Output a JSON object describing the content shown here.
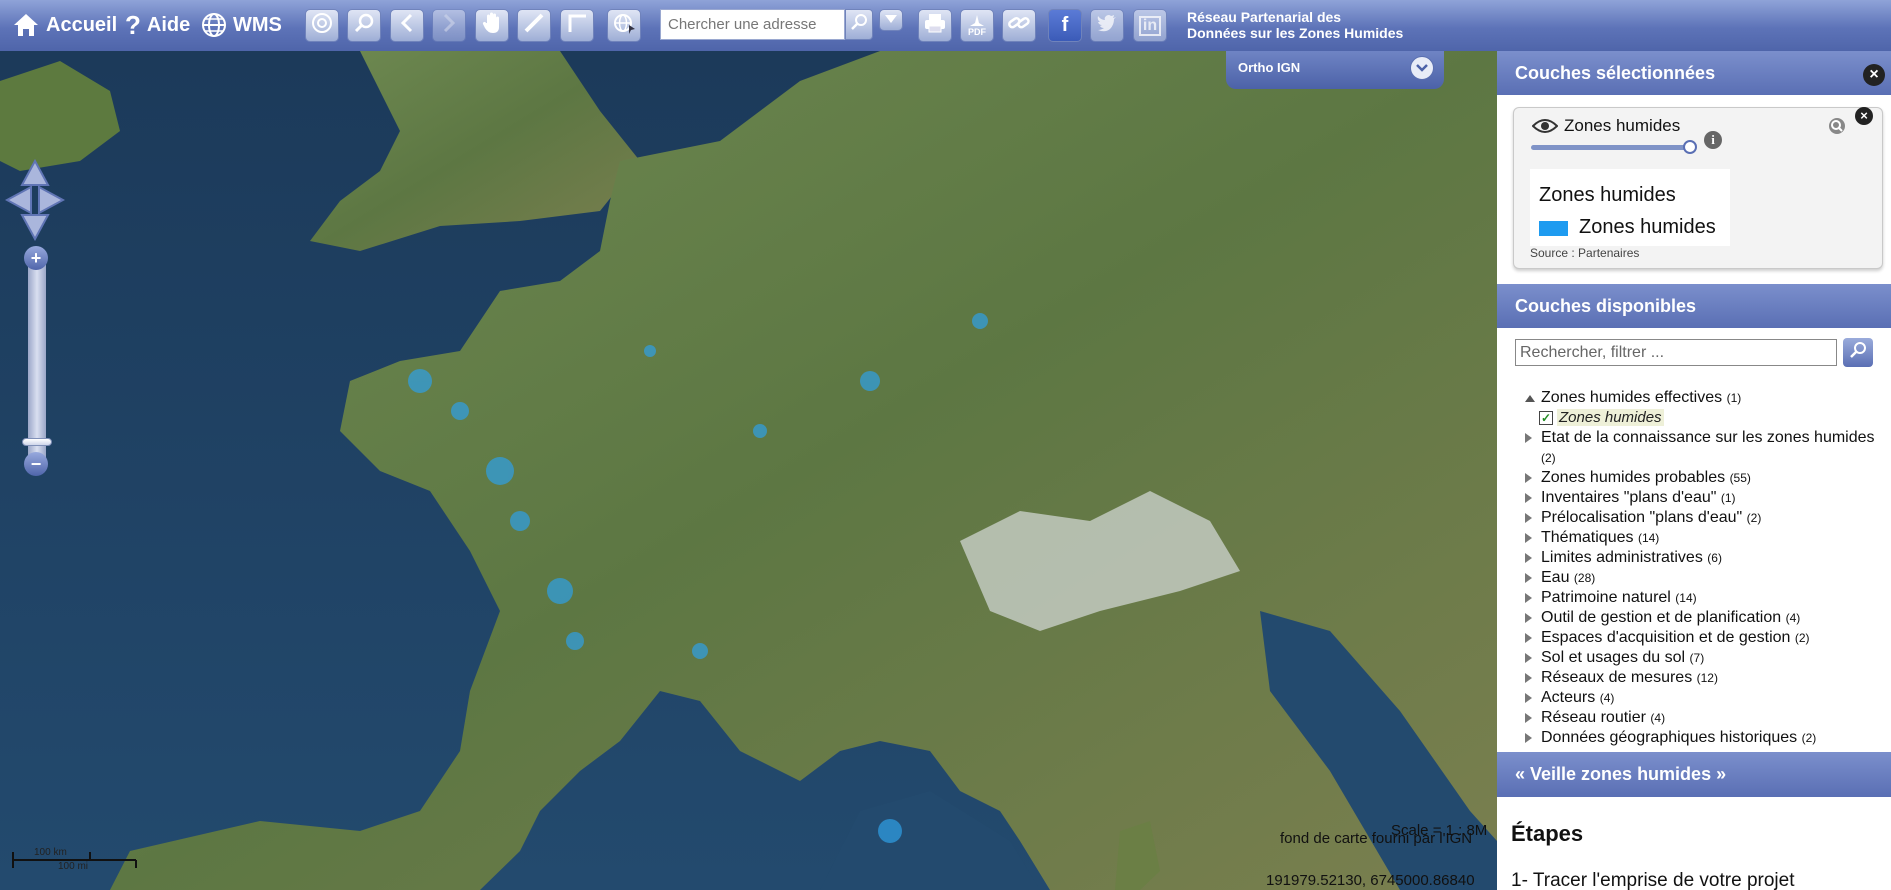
{
  "nav": {
    "home_label": "Accueil",
    "help_label": "Aide",
    "wms_label": "WMS"
  },
  "toolbar": {
    "search_placeholder": "Chercher une adresse",
    "site_title_line1": "Réseau Partenarial des",
    "site_title_line2": "Données sur les Zones Humides",
    "pdf_label": "PDF",
    "facebook_label": "f",
    "linkedin_label": "in"
  },
  "map": {
    "basemap_label": "Ortho IGN",
    "scale_km": "100 km",
    "scale_mi": "100 mi",
    "scale_text": "Scale = 1 : 8M",
    "attribution": "fond de carte fourni par l'IGN",
    "coordinates": "191979.52130, 6745000.86840"
  },
  "selected_layers": {
    "header": "Couches sélectionnées",
    "layer_name": "Zones humides",
    "opacity": 1.0,
    "legend_title": "Zones humides",
    "legend_item": "Zones humides",
    "legend_color": "#1e9bf0",
    "source": "Source : Partenaires"
  },
  "available_layers": {
    "header": "Couches disponibles",
    "filter_placeholder": "Rechercher, filtrer ...",
    "groups": [
      {
        "label": "Zones humides effectives",
        "count": "(1)",
        "expanded": true
      },
      {
        "label": "Etat de la connaissance sur les zones humides",
        "count": "(2)"
      },
      {
        "label": "Zones humides probables",
        "count": "(55)"
      },
      {
        "label": "Inventaires \"plans d'eau\"",
        "count": "(1)"
      },
      {
        "label": "Prélocalisation \"plans d'eau\"",
        "count": "(2)"
      },
      {
        "label": "Thématiques",
        "count": "(14)"
      },
      {
        "label": "Limites administratives",
        "count": "(6)"
      },
      {
        "label": "Eau",
        "count": "(28)"
      },
      {
        "label": "Patrimoine naturel",
        "count": "(14)"
      },
      {
        "label": "Outil de gestion et de planification",
        "count": "(4)"
      },
      {
        "label": "Espaces d'acquisition et de gestion",
        "count": "(2)"
      },
      {
        "label": "Sol et usages du sol",
        "count": "(7)"
      },
      {
        "label": "Réseaux de mesures",
        "count": "(12)"
      },
      {
        "label": "Acteurs",
        "count": "(4)"
      },
      {
        "label": "Réseau routier",
        "count": "(4)"
      },
      {
        "label": "Données géographiques historiques",
        "count": "(2)"
      }
    ],
    "sub_layer": "Zones humides"
  },
  "veille": {
    "label": "« Veille zones humides »"
  },
  "etapes": {
    "title": "Étapes",
    "step1_num": "1-",
    "step1_text": "Tracer l'emprise de votre projet"
  },
  "colors": {
    "toolbar": "#5d73b8",
    "panel_header": "#6a7fc0",
    "sea": "#1d3c5e",
    "land": "#5f7a45",
    "wetland": "#2fa0e6"
  }
}
